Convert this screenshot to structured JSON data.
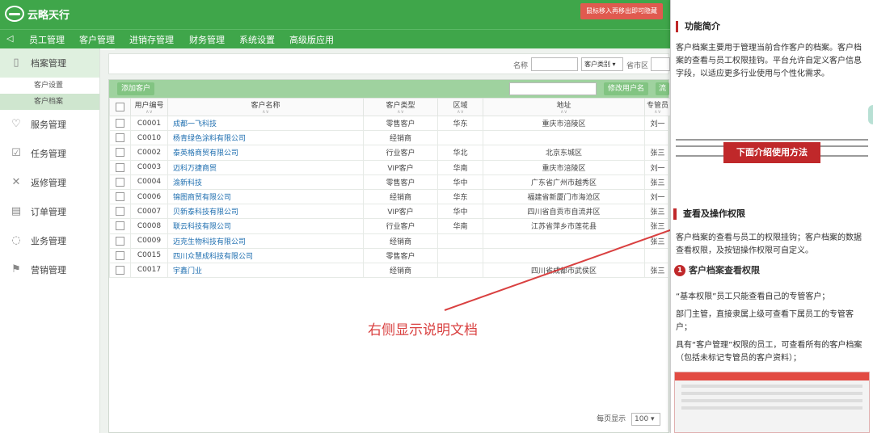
{
  "app": {
    "brand": "云略天行",
    "hover_hint": "鼠标移入再移出即可隐藏"
  },
  "nav": {
    "toggle": "◁",
    "items": [
      {
        "label": "员工管理",
        "active": false
      },
      {
        "label": "客户管理",
        "active": true
      },
      {
        "label": "进销存管理",
        "active": false
      },
      {
        "label": "财务管理",
        "active": false
      },
      {
        "label": "系统设置",
        "active": false
      },
      {
        "label": "高级版应用",
        "active": false
      }
    ]
  },
  "sidebar": {
    "items": [
      {
        "label": "档案管理",
        "icon": "file-icon",
        "glyph": "▯",
        "active": true
      },
      {
        "label": "服务管理",
        "icon": "heart-icon",
        "glyph": "♡"
      },
      {
        "label": "任务管理",
        "icon": "clipboard-icon",
        "glyph": "☑"
      },
      {
        "label": "返修管理",
        "icon": "wrench-icon",
        "glyph": "✕"
      },
      {
        "label": "订单管理",
        "icon": "order-icon",
        "glyph": "▤"
      },
      {
        "label": "业务管理",
        "icon": "cycle-icon",
        "glyph": "◌"
      },
      {
        "label": "营销管理",
        "icon": "flag-icon",
        "glyph": "⚑"
      }
    ],
    "subitems": [
      {
        "label": "客户设置",
        "active": false
      },
      {
        "label": "客户档案",
        "active": true
      }
    ]
  },
  "search": {
    "name_label": "名称",
    "type_select": "客户类别 ▾",
    "province_label": "省市区"
  },
  "toolbar": {
    "add_label": "添加客户",
    "rename_label": "修改用户名",
    "more_label": "流"
  },
  "table": {
    "columns": [
      "用户编号",
      "客户名称",
      "客户类型",
      "区域",
      "地址",
      "专管员"
    ],
    "rows": [
      [
        "C0001",
        "成都一飞科技",
        "零售客户",
        "华东",
        "重庆市涪陵区",
        "刘一"
      ],
      [
        "C0010",
        "杨青绿色涂料有限公司",
        "经销商",
        "",
        "",
        ""
      ],
      [
        "C0002",
        "泰英格商贸有限公司",
        "行业客户",
        "华北",
        "北京东城区",
        "张三"
      ],
      [
        "C0003",
        "迈科万捷商贸",
        "VIP客户",
        "华南",
        "重庆市涪陵区",
        "刘一"
      ],
      [
        "C0004",
        "渝新科技",
        "零售客户",
        "华中",
        "广东省广州市越秀区",
        "张三"
      ],
      [
        "C0006",
        "锦图商贸有限公司",
        "经销商",
        "华东",
        "福建省新厦门市海沧区",
        "刘一"
      ],
      [
        "C0007",
        "贝新泰科技有限公司",
        "VIP客户",
        "华中",
        "四川省自贡市自流井区",
        "张三"
      ],
      [
        "C0008",
        "联云科技有限公司",
        "行业客户",
        "华南",
        "江苏省萍乡市莲花县",
        "张三"
      ],
      [
        "C0009",
        "迈克生物科技有限公司",
        "经销商",
        "",
        "",
        "张三"
      ],
      [
        "C0015",
        "四川众慧成科技有限公司",
        "零售客户",
        "",
        "",
        ""
      ],
      [
        "C0017",
        "宇鑫门业",
        "经销商",
        "",
        "四川省成都市武侯区",
        "张三"
      ]
    ]
  },
  "pager": {
    "label": "每页显示",
    "value": "100 ▾"
  },
  "annotation": {
    "text": "右侧显示说明文档",
    "color": "#d94040"
  },
  "doc": {
    "intro_title": "功能简介",
    "intro_text": "客户档案主要用于管理当前合作客户的档案。客户档案的查看与员工权限挂钩。平台允许自定义客户信息字段，以适应更多行业使用与个性化需求。",
    "banner": "下面介绍使用方法",
    "perm_title": "查看及操作权限",
    "perm_text": "客户档案的查看与员工的权限挂钩；客户档案的数据查看权限，及按钮操作权限可自定义。",
    "step_number": "1",
    "step_title": "客户档案查看权限",
    "line1": "“基本权限”员工只能查看自己的专管客户；",
    "line2": "部门主管，直接隶属上级可查看下属员工的专管客户；",
    "line3": "具有“客户管理”权限的员工，可查看所有的客户档案（包括未标记专管员的客户资料）；"
  }
}
